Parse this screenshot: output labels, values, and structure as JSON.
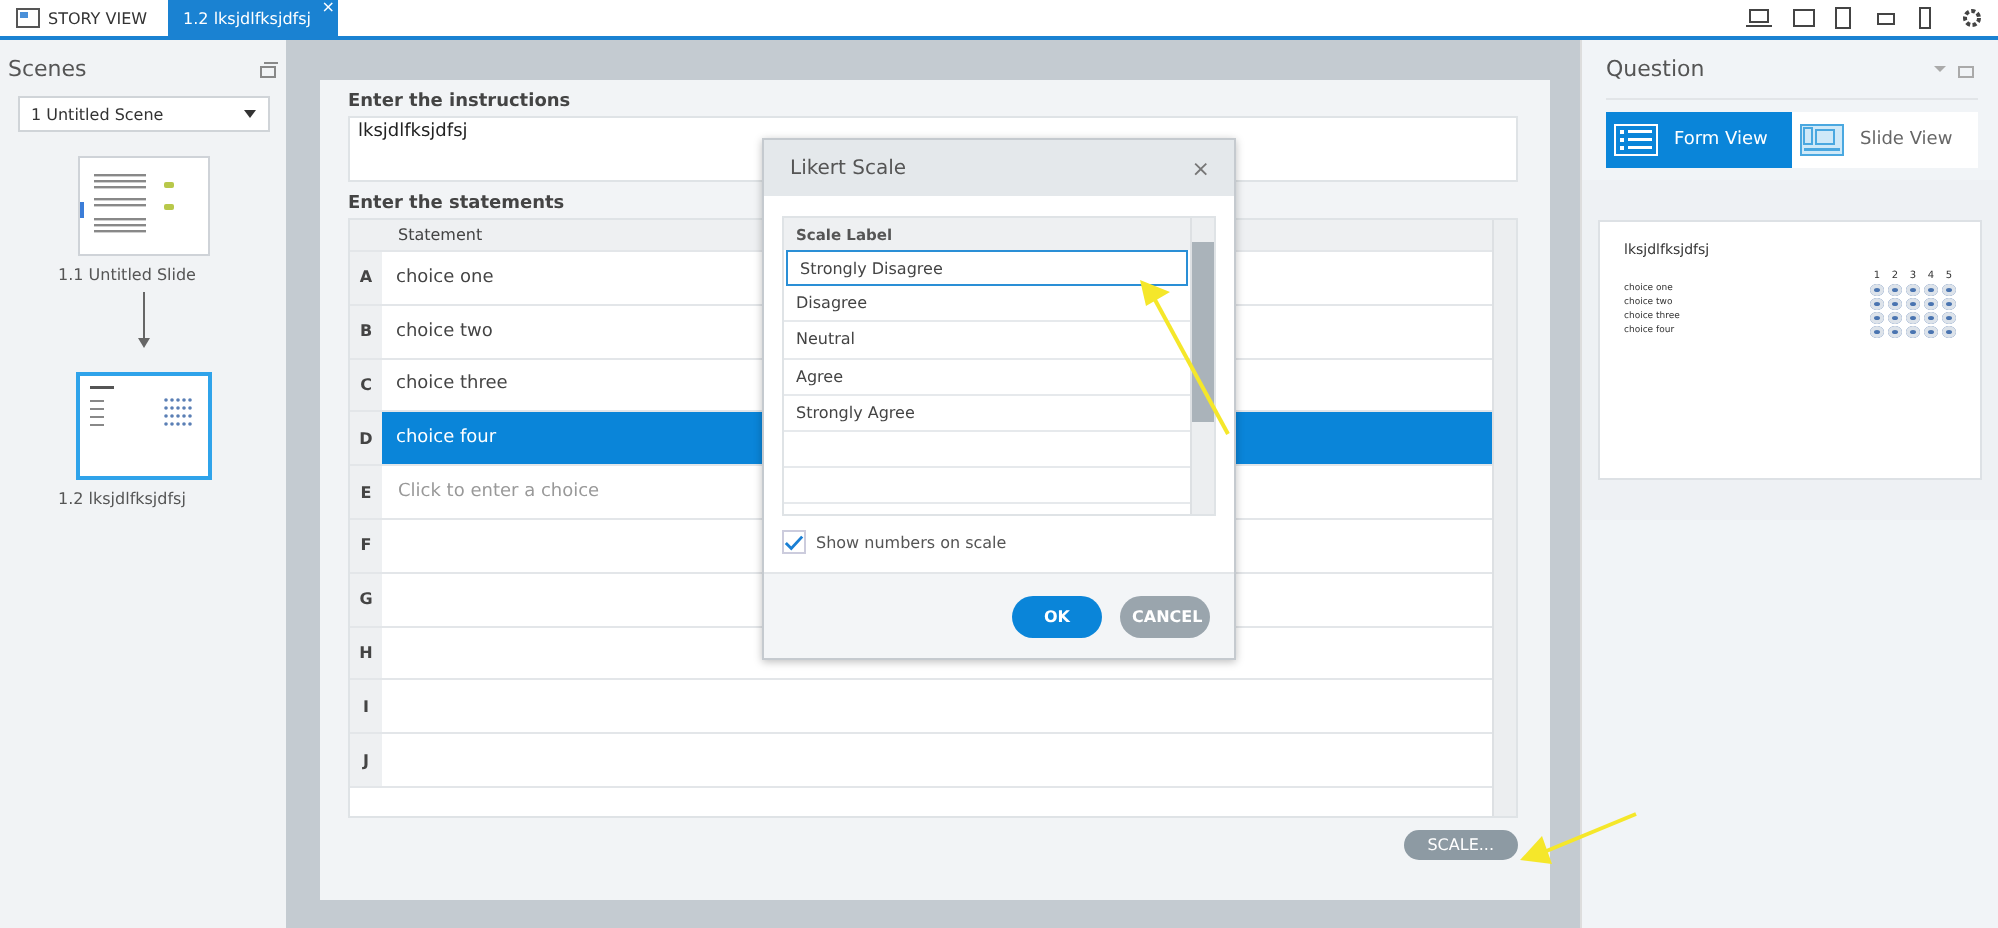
{
  "tabs": [
    {
      "label": "STORY VIEW",
      "selected": false,
      "kind": "story"
    },
    {
      "label": "1.2 lksjdlfksjdfsj",
      "selected": true,
      "kind": "slide",
      "close": "×"
    }
  ],
  "scenes": {
    "title": "Scenes",
    "dropdown": "1 Untitled Scene",
    "slides": [
      {
        "label": "1.1 Untitled Slide",
        "selected": false,
        "kind": "text"
      },
      {
        "label": "1.2 lksjdlfksjdfsj",
        "selected": true,
        "kind": "likert"
      }
    ]
  },
  "form": {
    "instructions_label": "Enter the instructions",
    "instructions": "lksjdlfksjdfsj",
    "statements_label": "Enter the statements",
    "column": "Statement",
    "rows": [
      {
        "letter": "A",
        "text": "choice one",
        "selected": false
      },
      {
        "letter": "B",
        "text": "choice two",
        "selected": false
      },
      {
        "letter": "C",
        "text": "choice three",
        "selected": false
      },
      {
        "letter": "D",
        "text": "choice four",
        "selected": true
      },
      {
        "letter": "E",
        "placeholder": "Click to enter a choice",
        "selected": false
      },
      {
        "letter": "F",
        "selected": false
      },
      {
        "letter": "G",
        "selected": false
      },
      {
        "letter": "H",
        "selected": false
      },
      {
        "letter": "I",
        "selected": false
      },
      {
        "letter": "J",
        "selected": false
      }
    ],
    "scale_button": "SCALE..."
  },
  "dialog": {
    "title": "Likert Scale",
    "close": "×",
    "column": "Scale Label",
    "labels": [
      {
        "text": "Strongly Disagree",
        "selected": true
      },
      {
        "text": "Disagree",
        "selected": false
      },
      {
        "text": "Neutral",
        "selected": false
      },
      {
        "text": "Agree",
        "selected": false
      },
      {
        "text": "Strongly Agree",
        "selected": false
      }
    ],
    "show_numbers": {
      "label": "Show numbers on scale",
      "checked": true
    },
    "buttons": [
      {
        "label": "OK",
        "kind": "primary"
      },
      {
        "label": "CANCEL",
        "kind": "secondary"
      }
    ]
  },
  "question": {
    "title": "Question",
    "views": [
      {
        "label": "Form View",
        "selected": true,
        "kind": "form"
      },
      {
        "label": "Slide View",
        "selected": false,
        "kind": "slide"
      }
    ],
    "preview": {
      "title": "lksjdlfksjdfsj",
      "scale": [
        "1",
        "2",
        "3",
        "4",
        "5"
      ],
      "choices": [
        "choice one",
        "choice two",
        "choice three",
        "choice four"
      ]
    }
  }
}
